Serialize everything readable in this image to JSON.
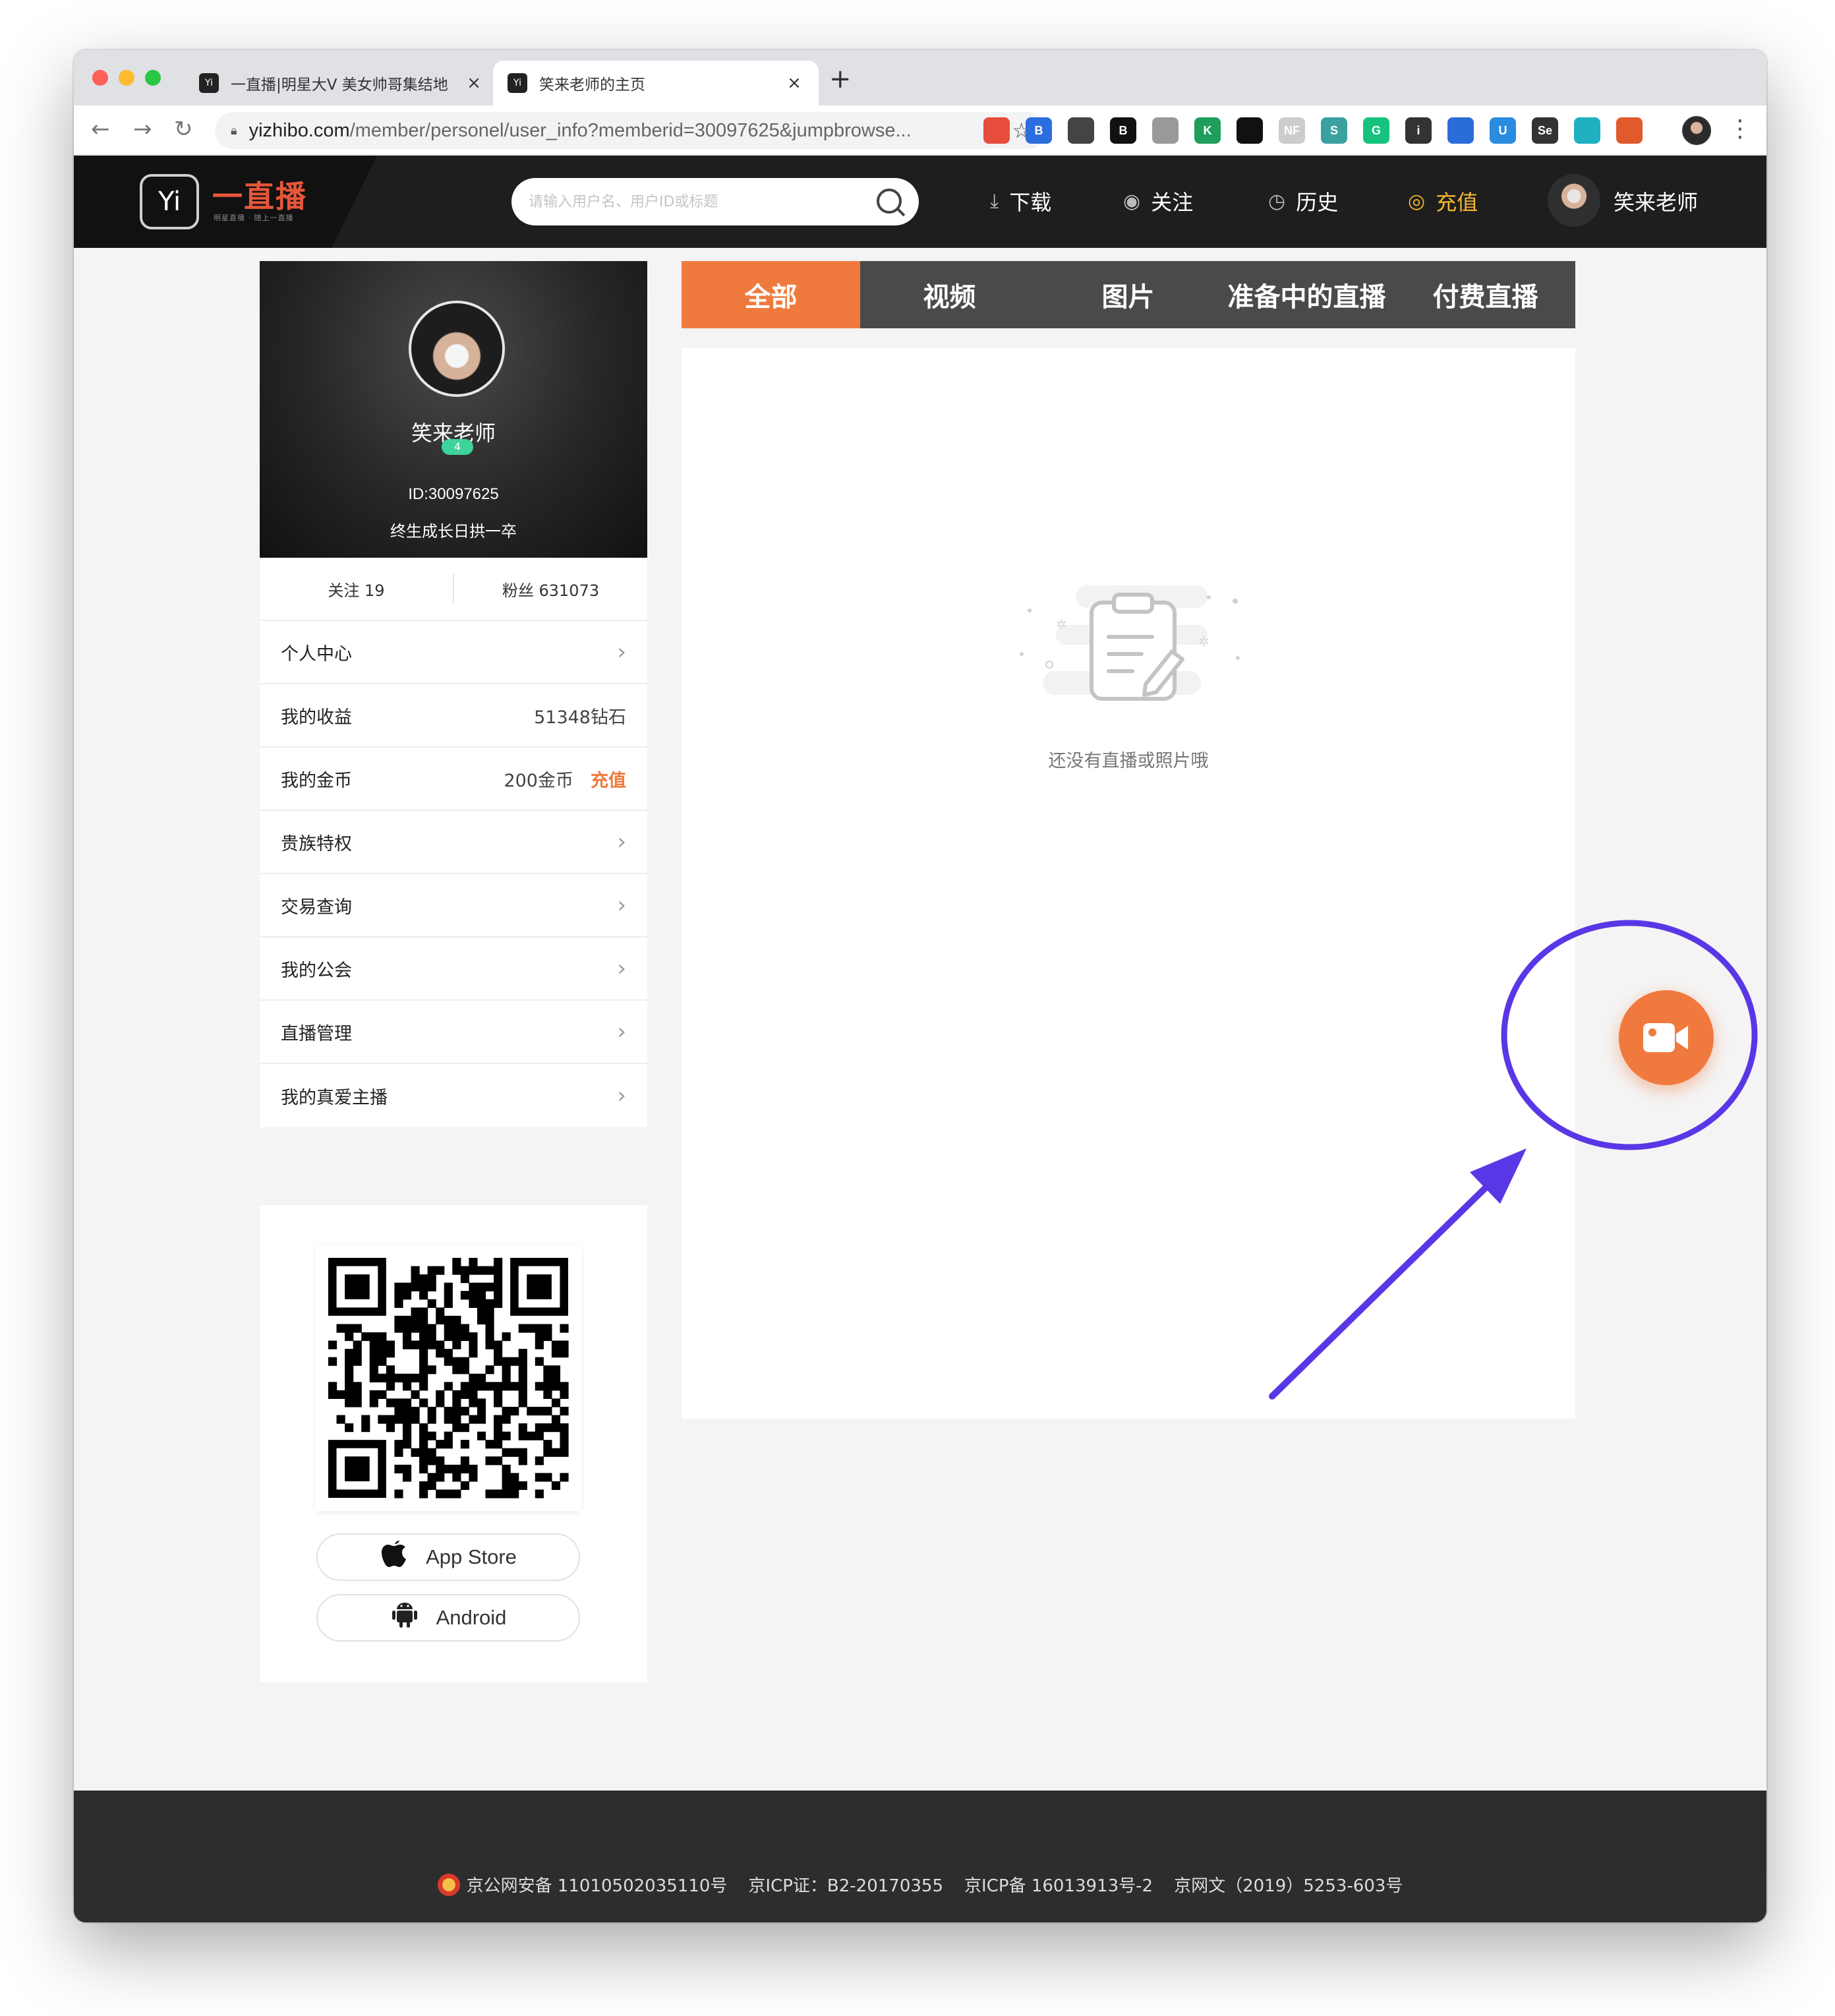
{
  "browser": {
    "tabs": [
      {
        "title": "一直播|明星大V 美女帅哥集结地",
        "favicon": "Yi",
        "active": false
      },
      {
        "title": "笑来老师的主页",
        "favicon": "Yi",
        "active": true
      }
    ],
    "url_host": "yizhibo.com",
    "url_path": "/member/personel/user_info?memberid=30097625&jumpbrowse...",
    "extensions": [
      {
        "icon": "chrome-color-icon",
        "label": "",
        "color": "#e74c3c"
      },
      {
        "icon": "translate-icon",
        "label": "B",
        "color": "#2c6de0"
      },
      {
        "icon": "screenshot-icon",
        "label": "",
        "color": "#444444"
      },
      {
        "icon": "b-icon",
        "label": "B",
        "color": "#111111"
      },
      {
        "icon": "shield-icon",
        "label": "",
        "color": "#999999"
      },
      {
        "icon": "k-icon",
        "label": "K",
        "color": "#1e9e5a"
      },
      {
        "icon": "dots-icon",
        "label": "",
        "color": "#111111"
      },
      {
        "icon": "nf-icon",
        "label": "NF",
        "color": "#cccccc"
      },
      {
        "icon": "s-icon",
        "label": "S",
        "color": "#3aa0a0"
      },
      {
        "icon": "grammarly-icon",
        "label": "G",
        "color": "#16c27e"
      },
      {
        "icon": "info-icon",
        "label": "i",
        "color": "#333333"
      },
      {
        "icon": "flag-icon",
        "label": "",
        "color": "#2b6dd8"
      },
      {
        "icon": "u-icon",
        "label": "U",
        "color": "#2b8be0"
      },
      {
        "icon": "se-icon",
        "label": "Se",
        "color": "#333333"
      },
      {
        "icon": "check-icon",
        "label": "",
        "color": "#20b0c0"
      },
      {
        "icon": "clip-icon",
        "label": "",
        "color": "#e05a2b"
      }
    ]
  },
  "header": {
    "logo_mark": "Yi",
    "logo_text": "一直播",
    "logo_sub": "明星直播 · 随上一直播",
    "search_placeholder": "请输入用户名、用户ID或标题",
    "nav": [
      {
        "icon": "download-icon",
        "label": "下载"
      },
      {
        "icon": "eye-icon",
        "label": "关注"
      },
      {
        "icon": "clock-icon",
        "label": "历史"
      },
      {
        "icon": "coin-icon",
        "label": "充值"
      }
    ],
    "username": "笑来老师",
    "accent_color": "#f4b730"
  },
  "profile": {
    "name": "笑来老师",
    "level": "4",
    "id_text": "ID:30097625",
    "motto": "终生成长日拱一卒",
    "following": "关注 19",
    "fans": "粉丝 631073"
  },
  "menu": [
    {
      "label": "个人中心",
      "value": "",
      "link": ""
    },
    {
      "label": "我的收益",
      "value": "51348钻石",
      "link": ""
    },
    {
      "label": "我的金币",
      "value": "200金币",
      "link": "充值"
    },
    {
      "label": "贵族特权",
      "value": "",
      "link": ""
    },
    {
      "label": "交易查询",
      "value": "",
      "link": ""
    },
    {
      "label": "我的公会",
      "value": "",
      "link": ""
    },
    {
      "label": "直播管理",
      "value": "",
      "link": ""
    },
    {
      "label": "我的真爱主播",
      "value": "",
      "link": ""
    }
  ],
  "download": {
    "app_store": "App Store",
    "android": "Android"
  },
  "content": {
    "tabs": [
      "全部",
      "视频",
      "图片",
      "准备中的直播",
      "付费直播"
    ],
    "active_tab": 0,
    "empty_text": "还没有直播或照片哦",
    "accent_color": "#f07a3e"
  },
  "footer": {
    "items": [
      "京公网安备 11010502035110号",
      "京ICP证：B2-20170355",
      "京ICP备 16013913号-2",
      "京网文（2019）5253-603号"
    ]
  },
  "annotation": {
    "color": "#5a37e6"
  }
}
